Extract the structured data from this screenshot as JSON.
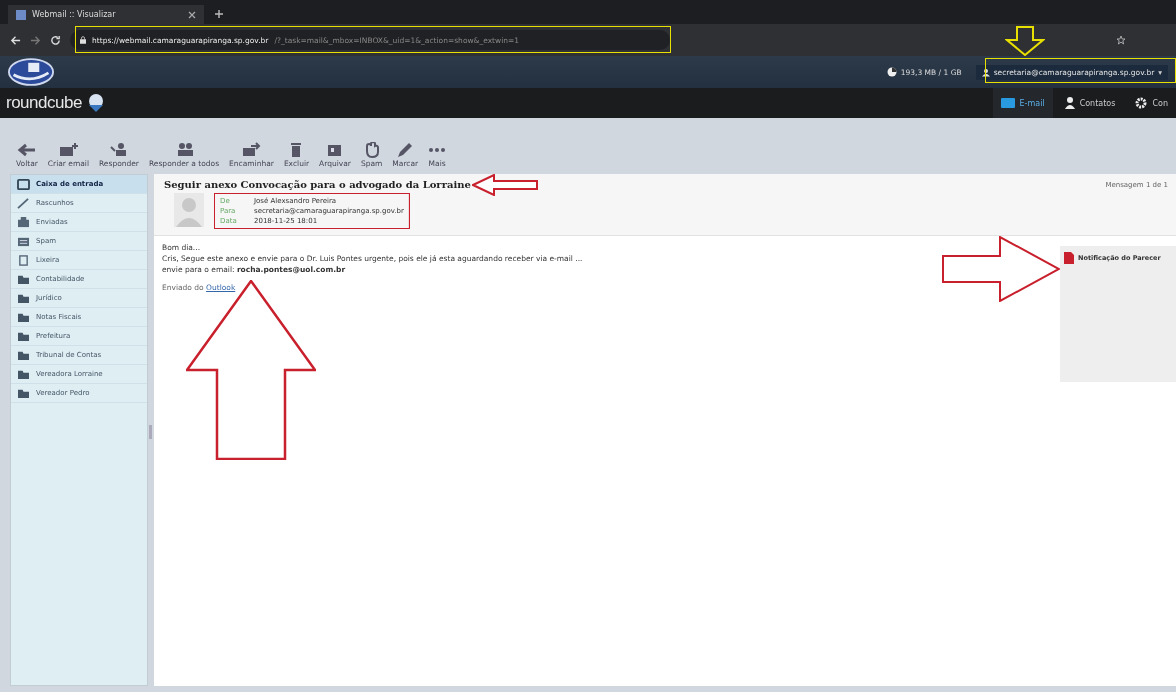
{
  "browser": {
    "tab_title": "Webmail :: Visualizar",
    "url_host": "https://webmail.camaraguarapiranga.sp.gov.br",
    "url_path": "/?_task=mail&_mbox=INBOX&_uid=1&_action=show&_extwin=1"
  },
  "header": {
    "quota": "193,3 MB / 1 GB",
    "user": "secretaria@camaraguarapiranga.sp.gov.br",
    "user_caret": "▾",
    "brand": "roundcube"
  },
  "nav": [
    {
      "label": "E-mail",
      "kind": "mail",
      "selected": true
    },
    {
      "label": "Contatos",
      "kind": "contacts",
      "selected": false
    },
    {
      "label": "Con",
      "kind": "settings",
      "selected": false
    }
  ],
  "toolbar": [
    {
      "label": "Voltar",
      "kind": "back"
    },
    {
      "label": "Criar email",
      "kind": "compose"
    },
    {
      "label": "Responder",
      "kind": "reply"
    },
    {
      "label": "Responder a todos",
      "kind": "replyall"
    },
    {
      "label": "Encaminhar",
      "kind": "forward"
    },
    {
      "label": "Excluir",
      "kind": "delete"
    },
    {
      "label": "Arquivar",
      "kind": "archive"
    },
    {
      "label": "Spam",
      "kind": "spam"
    },
    {
      "label": "Marcar",
      "kind": "mark"
    },
    {
      "label": "Mais",
      "kind": "more"
    }
  ],
  "folders": [
    {
      "label": "Caixa de entrada",
      "kind": "inbox",
      "selected": true
    },
    {
      "label": "Rascunhos",
      "kind": "drafts",
      "selected": false
    },
    {
      "label": "Enviadas",
      "kind": "sent",
      "selected": false
    },
    {
      "label": "Spam",
      "kind": "spam",
      "selected": false
    },
    {
      "label": "Lixeira",
      "kind": "trash",
      "selected": false
    },
    {
      "label": "Contabilidade",
      "kind": "folder",
      "selected": false
    },
    {
      "label": "Jurídico",
      "kind": "folder",
      "selected": false
    },
    {
      "label": "Notas Fiscais",
      "kind": "folder",
      "selected": false
    },
    {
      "label": "Prefeitura",
      "kind": "folder",
      "selected": false
    },
    {
      "label": "Tribunal de Contas",
      "kind": "folder",
      "selected": false
    },
    {
      "label": "Vereadora Lorraine",
      "kind": "folder",
      "selected": false
    },
    {
      "label": "Vereador Pedro",
      "kind": "folder",
      "selected": false
    }
  ],
  "message": {
    "subject": "Seguir anexo Convocação para o advogado da Lorraine",
    "counter": "Mensagem 1 de 1",
    "headers": [
      {
        "label": "De",
        "value": "José Alexsandro Pereira"
      },
      {
        "label": "Para",
        "value": "secretaria@camaraguarapiranga.sp.gov.br"
      },
      {
        "label": "Data",
        "value": "2018-11-25 18:01"
      }
    ],
    "body": [
      "Bom dia...",
      "Cris, Segue este anexo e envie para o Dr. Luis Pontes urgente, pois ele já esta aguardando receber via e-mail ...",
      "envie para o email: **rocha.pontes@uol.com.br**"
    ],
    "signature_prefix": "Enviado do",
    "signature_link": "Outlook",
    "attachment": "Notificação do Parecer"
  }
}
